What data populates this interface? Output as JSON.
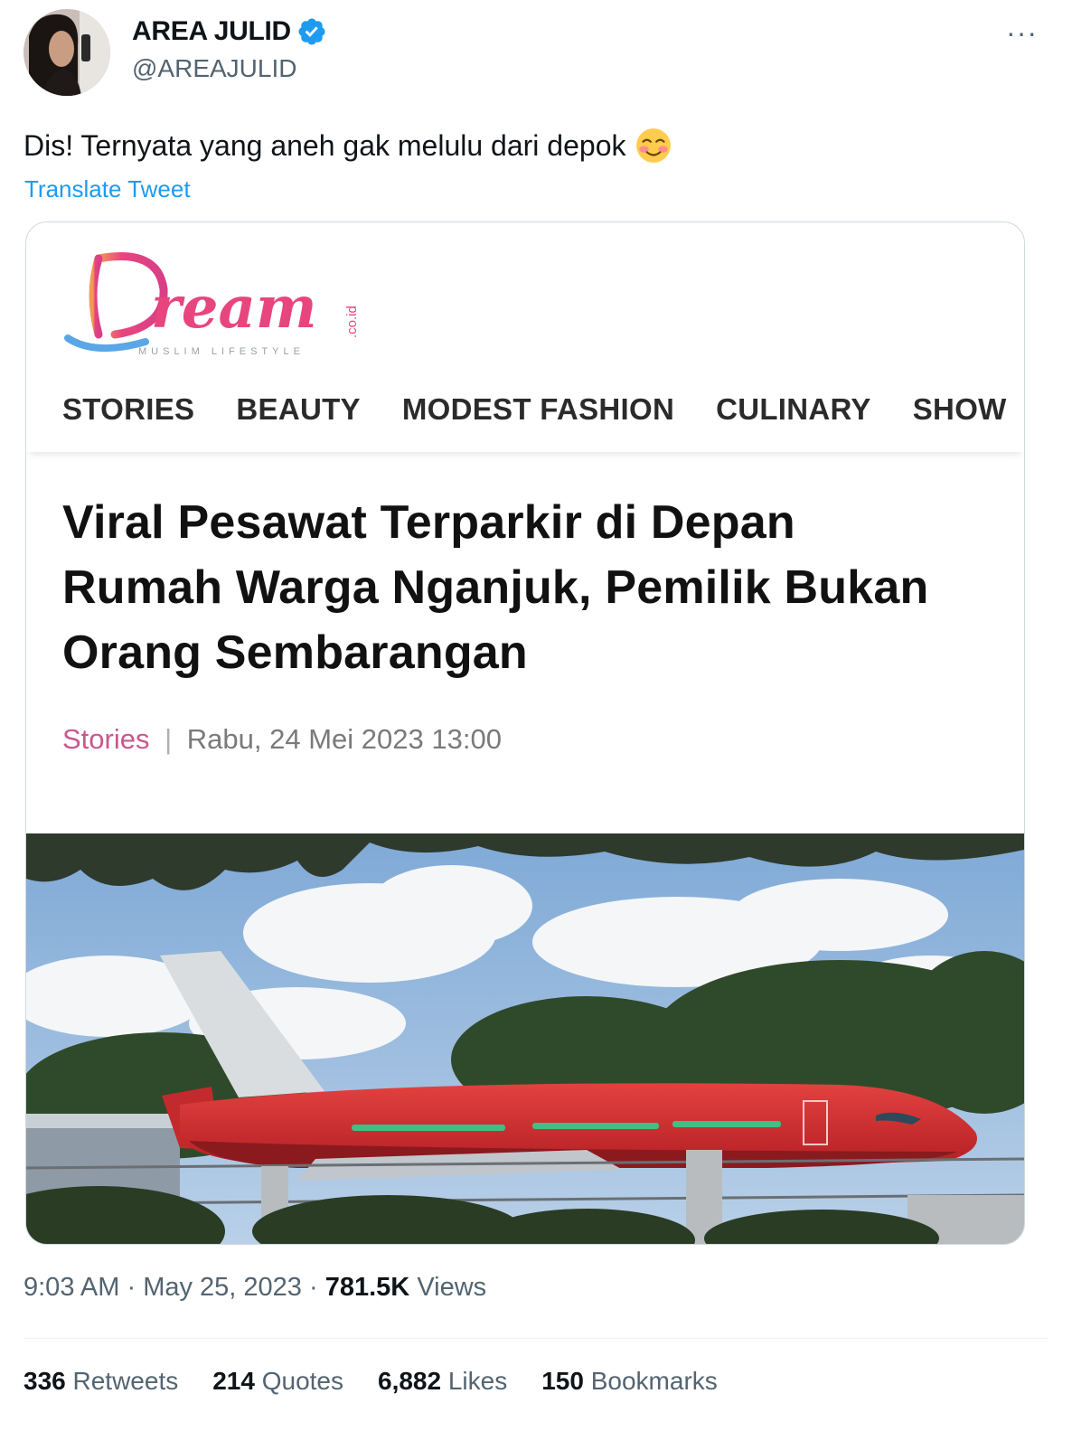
{
  "author": {
    "display_name": "AREA JULID",
    "handle": "@AREAJULID",
    "avatar_icon": "user-avatar",
    "verified_icon": "verified-badge-icon"
  },
  "actions": {
    "more_label": "···"
  },
  "tweet": {
    "text": "Dis! Ternyata yang aneh gak melulu dari depok",
    "emoji_icon": "smiling-face-with-blush-icon",
    "translate_label": "Translate Tweet"
  },
  "media": {
    "logo_text": "Dream",
    "logo_domain": ".co.id",
    "logo_tagline": "MUSLIM LIFESTYLE",
    "nav": [
      "STORIES",
      "BEAUTY",
      "MODEST FASHION",
      "CULINARY",
      "SHOW"
    ],
    "headline": "Viral Pesawat Terparkir di Depan Rumah Warga Nganjuk, Pemilik Bukan Orang Sembarangan",
    "category": "Stories",
    "separator": "|",
    "date": "Rabu, 24 Mei 2023 13:00",
    "photo_icon": "red-airplane-photo"
  },
  "meta": {
    "time": "9:03 AM",
    "dot": "·",
    "date": "May 25, 2023",
    "views_count": "781.5K",
    "views_label": "Views"
  },
  "stats": {
    "retweets_count": "336",
    "retweets_label": "Retweets",
    "quotes_count": "214",
    "quotes_label": "Quotes",
    "likes_count": "6,882",
    "likes_label": "Likes",
    "bookmarks_count": "150",
    "bookmarks_label": "Bookmarks"
  },
  "colors": {
    "link": "#1d9bf0",
    "verified": "#1d9bf0",
    "secondary_text": "#536471",
    "dream_pink": "#e8457f",
    "dream_blue": "#5aa6e6",
    "plane_red": "#d0262b"
  }
}
